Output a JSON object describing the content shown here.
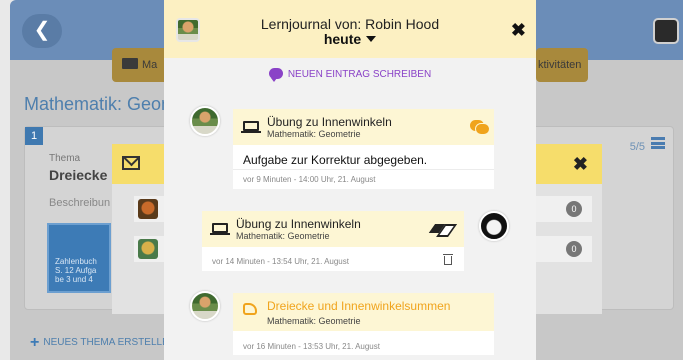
{
  "background": {
    "buttons": [
      {
        "label": "Ma"
      },
      {
        "label": "ktivitäten"
      }
    ],
    "page_title": "Mathematik: Geom",
    "card": {
      "number": "1",
      "label": "Thema",
      "title": "Dreiecke u",
      "description": "Beschreibun",
      "book_lines": [
        "Zahlenbuch",
        "S. 12 Aufga",
        "be 3 und 4"
      ],
      "count": "5/5"
    },
    "new_topic": "NEUES THEMA ERSTELLE"
  },
  "overlay": {
    "badges": [
      "0",
      "0"
    ]
  },
  "journal": {
    "title": "Lernjournal von: Robin Hood",
    "date_filter": "heute",
    "new_entry_label": "NEUEN EINTRAG SCHREIBEN",
    "entries": [
      {
        "title": "Übung zu Innenwinkeln",
        "subject": "Mathematik: Geometrie",
        "text": "Aufgabe zur Korrektur abgegeben.",
        "time": "vor 9 Minuten - 14:00 Uhr, 21. August"
      },
      {
        "title": "Übung zu Innenwinkeln",
        "subject": "Mathematik: Geometrie",
        "time": "vor 14 Minuten - 13:54 Uhr, 21. August"
      },
      {
        "title": "Dreiecke und Innenwinkelsummen",
        "subject": "Mathematik: Geometrie",
        "time": "vor 16 Minuten - 13:53 Uhr, 21. August"
      }
    ]
  },
  "colors": {
    "header_yellow": "#fcf0c2",
    "accent_purple": "#8a42c7",
    "accent_orange": "#f0a41d",
    "primary_blue": "#3d7bb6"
  },
  "icons": [
    "back-arrow-icon",
    "user-avatar-icon",
    "folder-icon",
    "envelope-icon",
    "close-icon",
    "chat-bubble-icon",
    "laptop-icon",
    "eraser-icon",
    "trash-icon",
    "hand-point-icon",
    "plus-icon",
    "menu-icon",
    "chevron-down-icon"
  ]
}
